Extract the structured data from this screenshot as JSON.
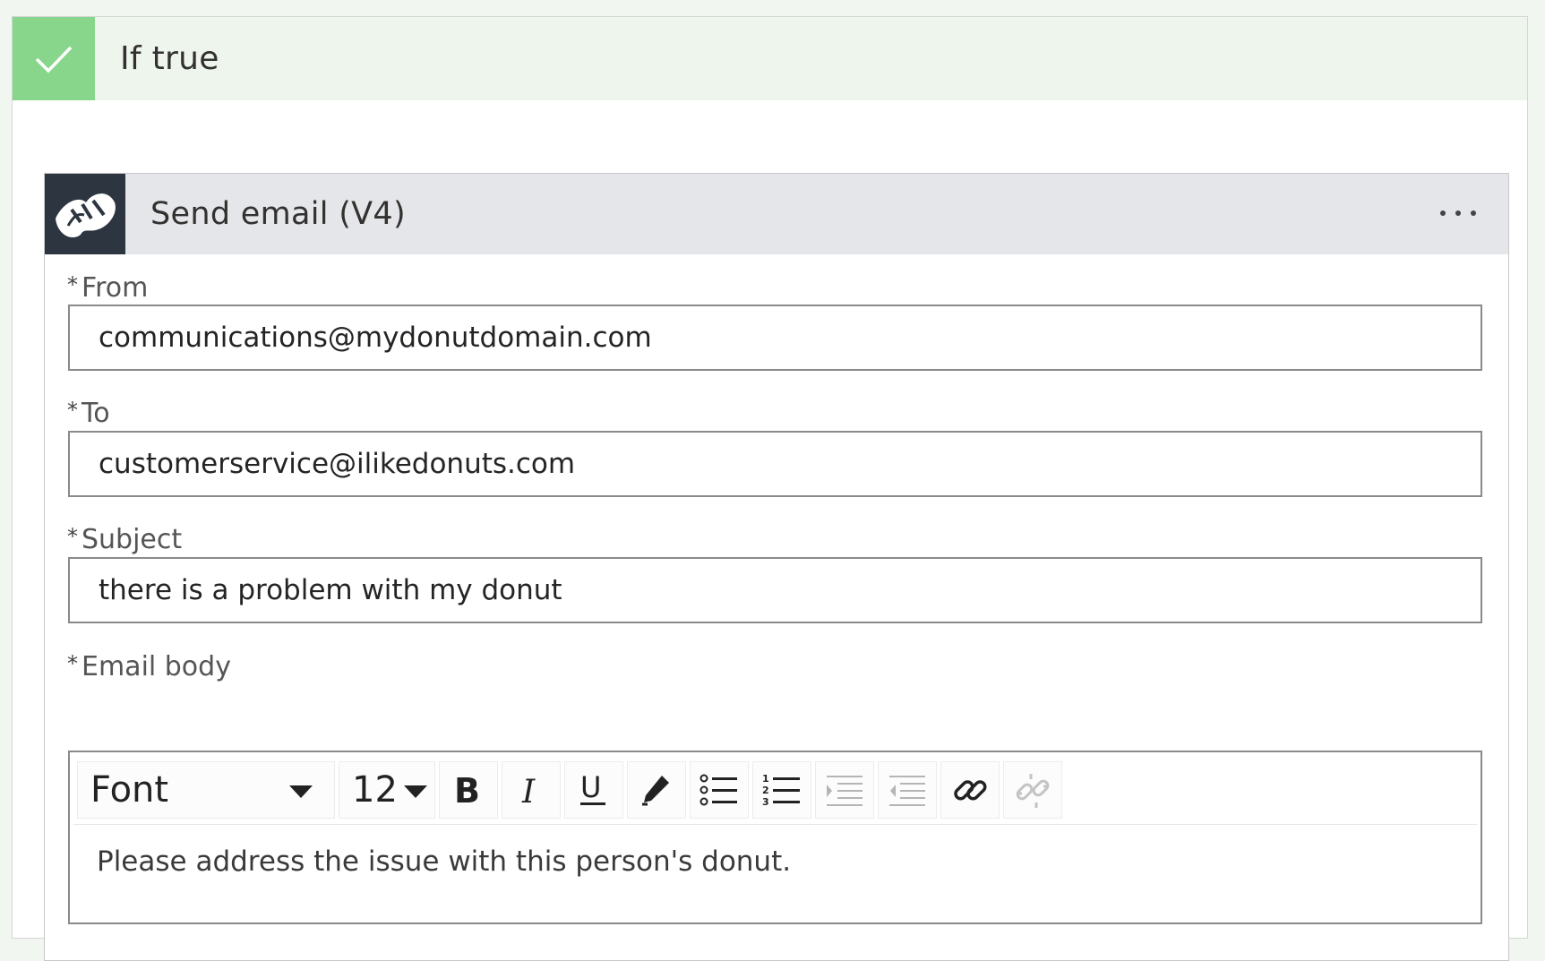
{
  "condition": {
    "title": "If true",
    "header_bg": "#eef5ed",
    "check_bg": "#87d68c",
    "icon": "checkmark-icon"
  },
  "action": {
    "title": "Send email (V4)",
    "icon": "sendgrid-icon",
    "icon_bg": "#2c3540",
    "menu_icon": "more-options-icon"
  },
  "fields": {
    "from": {
      "required_mark": "*",
      "label": "From",
      "value": "communications@mydonutdomain.com"
    },
    "to": {
      "required_mark": "*",
      "label": "To",
      "value": "customerservice@ilikedonuts.com"
    },
    "subject": {
      "required_mark": "*",
      "label": "Subject",
      "value": "there is a problem with my donut"
    },
    "body": {
      "required_mark": "*",
      "label": "Email body",
      "value": "Please address the issue with this person's donut."
    }
  },
  "toolbar": {
    "font": "Font",
    "size": "12",
    "buttons": [
      "bold-icon",
      "italic-icon",
      "underline-icon",
      "text-color-icon",
      "bullet-list-icon",
      "numbered-list-icon",
      "decrease-indent-icon",
      "increase-indent-icon",
      "link-icon",
      "unlink-icon"
    ]
  }
}
